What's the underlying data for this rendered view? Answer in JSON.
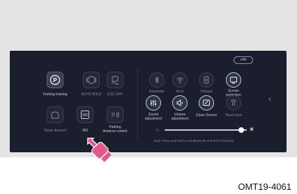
{
  "panel": {
    "edit_label": "edit",
    "left_tiles": [
      {
        "label": "Parking braking",
        "icon": "parking-brake-icon"
      },
      {
        "label": "AUTO HOLD",
        "icon": "auto-hold-icon"
      },
      {
        "label": "ESC OFF",
        "icon": "esc-off-icon"
      },
      {
        "label": "Steep descent",
        "icon": "steep-descent-icon"
      },
      {
        "label": "360",
        "icon": "camera-360-icon"
      },
      {
        "label": "Parking\ndistance control",
        "icon": "parking-distance-icon"
      }
    ],
    "right_tiles": [
      {
        "label": "Bluetooth",
        "icon": "bluetooth-icon"
      },
      {
        "label": "Wi-Fi",
        "icon": "wifi-icon"
      },
      {
        "label": "Hotspot",
        "icon": "hotspot-icon"
      },
      {
        "label": "Screen\nprotection",
        "icon": "screen-protection-icon"
      },
      {
        "label": "Sound\nadjustment",
        "icon": "sound-adjustment-icon"
      },
      {
        "label": "Volume\nadjustment",
        "icon": "volume-icon"
      },
      {
        "label": "Clean Screen",
        "icon": "clean-screen-icon"
      },
      {
        "label": "Touch tone",
        "icon": "touch-tone-icon"
      }
    ],
    "brightness_level": 0.93,
    "note": "Note: Press and hold to set Bluetooth and Wi-Fi functions"
  },
  "figure_code": "OMT19-4061",
  "colors": {
    "screen_bg": "#1b1e2d",
    "pointer": "#e05a8c"
  }
}
